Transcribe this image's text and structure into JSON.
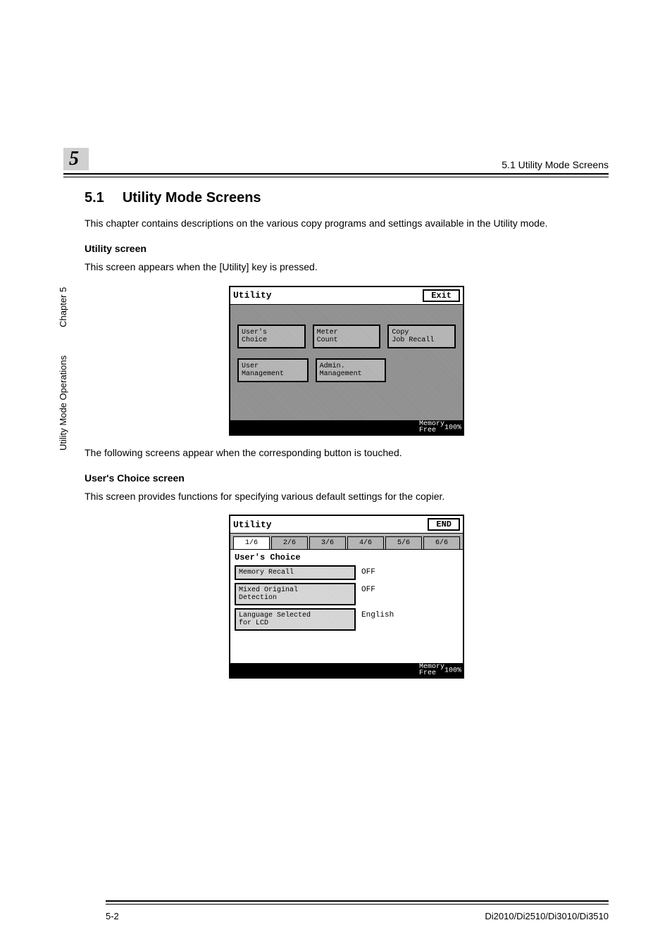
{
  "header": {
    "chapter_number": "5",
    "running_head": "5.1 Utility Mode Screens"
  },
  "section": {
    "number": "5.1",
    "title": "Utility Mode Screens",
    "intro": "This chapter contains descriptions on the various copy programs and settings available in the Utility mode."
  },
  "sub1": {
    "heading": "Utility screen",
    "text": "This screen appears when the [Utility] key is pressed."
  },
  "lcd1": {
    "title": "Utility",
    "exit": "Exit",
    "btn_users_choice": "User's\nChoice",
    "btn_meter_count": "Meter\nCount",
    "btn_copy_job_recall": "Copy\nJob Recall",
    "btn_user_management": "User\nManagement",
    "btn_admin_management": "Admin.\nManagement",
    "memory_label": "Memory\nFree",
    "memory_value": "100%"
  },
  "mid_text": "The following screens appear when the corresponding button is touched.",
  "sub2": {
    "heading": "User's Choice screen",
    "text": "This screen provides functions for specifying various default settings for the copier."
  },
  "lcd2": {
    "title": "Utility",
    "end": "END",
    "tabs": [
      "1/6",
      "2/6",
      "3/6",
      "4/6",
      "5/6",
      "6/6"
    ],
    "heading": "User's Choice",
    "rows": [
      {
        "label": "Memory Recall",
        "value": "OFF"
      },
      {
        "label": "Mixed Original\nDetection",
        "value": "OFF"
      },
      {
        "label": "Language Selected\nfor LCD",
        "value": "English"
      }
    ],
    "memory_label": "Memory\nFree",
    "memory_value": "100%"
  },
  "sidetab": {
    "book": "Utility Mode Operations",
    "chapter": "Chapter 5"
  },
  "footer": {
    "page": "5-2",
    "model": "Di2010/Di2510/Di3010/Di3510"
  }
}
